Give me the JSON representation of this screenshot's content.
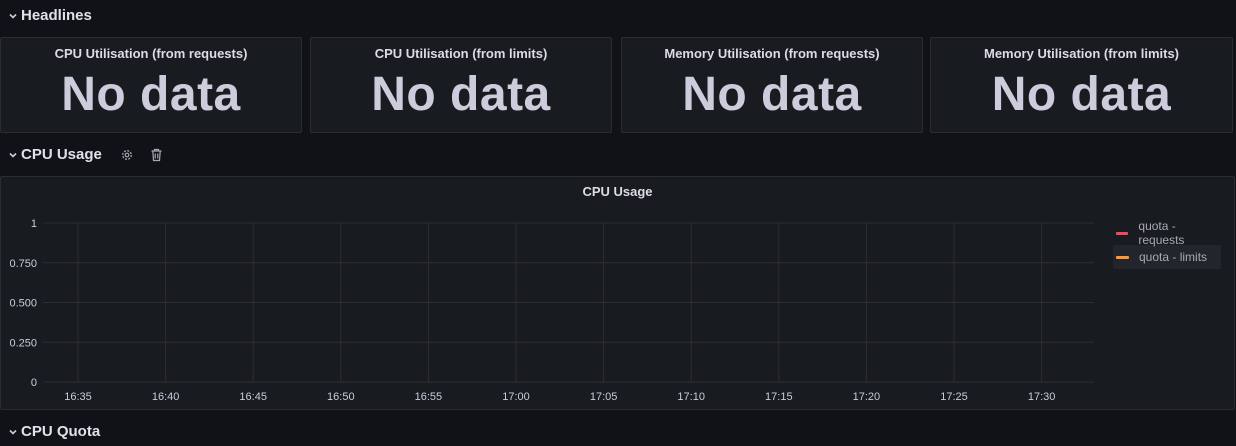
{
  "rows": {
    "headlines": {
      "title": "Headlines"
    },
    "cpu_usage": {
      "title": "CPU Usage"
    },
    "cpu_quota": {
      "title": "CPU Quota"
    }
  },
  "stats": [
    {
      "title": "CPU Utilisation (from requests)",
      "value": "No data"
    },
    {
      "title": "CPU Utilisation (from limits)",
      "value": "No data"
    },
    {
      "title": "Memory Utilisation (from requests)",
      "value": "No data"
    },
    {
      "title": "Memory Utilisation (from limits)",
      "value": "No data"
    }
  ],
  "chart_data": {
    "type": "line",
    "title": "CPU Usage",
    "x": [
      "16:35",
      "16:40",
      "16:45",
      "16:50",
      "16:55",
      "17:00",
      "17:05",
      "17:10",
      "17:15",
      "17:20",
      "17:25",
      "17:30"
    ],
    "y_ticks": [
      "0",
      "0.250",
      "0.500",
      "0.750",
      "1"
    ],
    "ylim": [
      0,
      1
    ],
    "grid": true,
    "legend_position": "right",
    "series": [
      {
        "name": "quota - requests",
        "color": "#f2495c",
        "values": []
      },
      {
        "name": "quota - limits",
        "color": "#ff9830",
        "values": []
      }
    ]
  }
}
